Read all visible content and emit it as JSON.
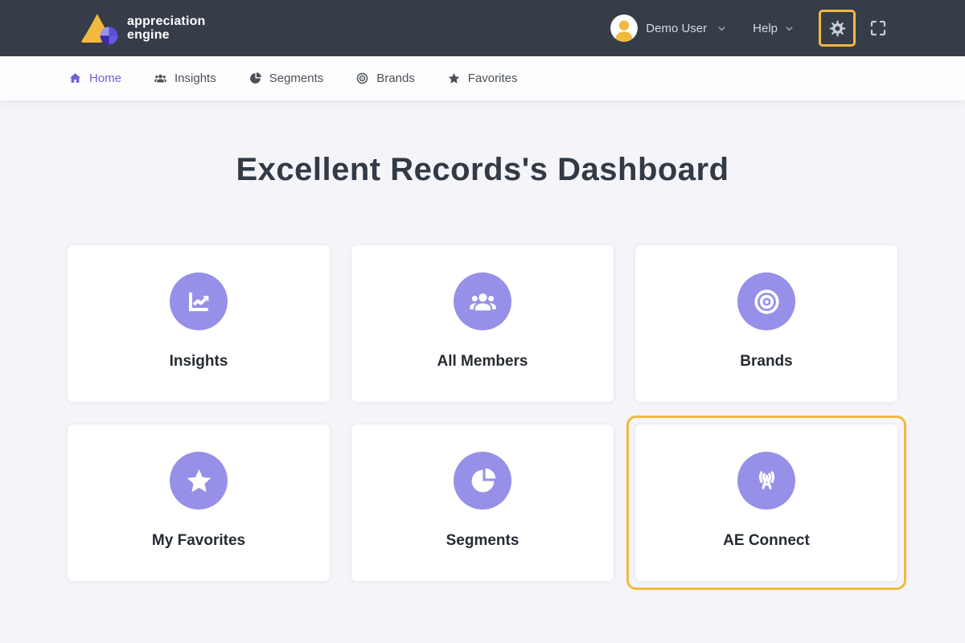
{
  "navbar": {
    "brand_line1": "appreciation",
    "brand_line2": "engine",
    "user_name": "Demo User",
    "help_label": "Help"
  },
  "nav": {
    "items": [
      {
        "label": "Home",
        "icon": "home-icon",
        "active": true
      },
      {
        "label": "Insights",
        "icon": "people-group-icon",
        "active": false
      },
      {
        "label": "Segments",
        "icon": "pie-chart-icon",
        "active": false
      },
      {
        "label": "Brands",
        "icon": "bullseye-icon",
        "active": false
      },
      {
        "label": "Favorites",
        "icon": "star-icon",
        "active": false
      }
    ]
  },
  "main": {
    "title": "Excellent Records's Dashboard",
    "cards": [
      {
        "label": "Insights",
        "icon": "chart-line-icon",
        "highlighted": false
      },
      {
        "label": "All Members",
        "icon": "people-group-icon",
        "highlighted": false
      },
      {
        "label": "Brands",
        "icon": "bullseye-icon",
        "highlighted": false
      },
      {
        "label": "My Favorites",
        "icon": "star-icon",
        "highlighted": false
      },
      {
        "label": "Segments",
        "icon": "pie-chart-icon",
        "highlighted": false
      },
      {
        "label": "AE Connect",
        "icon": "broadcast-icon",
        "highlighted": true
      }
    ]
  },
  "colors": {
    "navbar_bg": "#363d49",
    "page_bg": "#f5f5f9",
    "accent_purple": "#9790e8",
    "active_link_purple": "#6f63d8",
    "highlight_yellow": "#f2b93f",
    "card_bg": "#ffffff"
  }
}
